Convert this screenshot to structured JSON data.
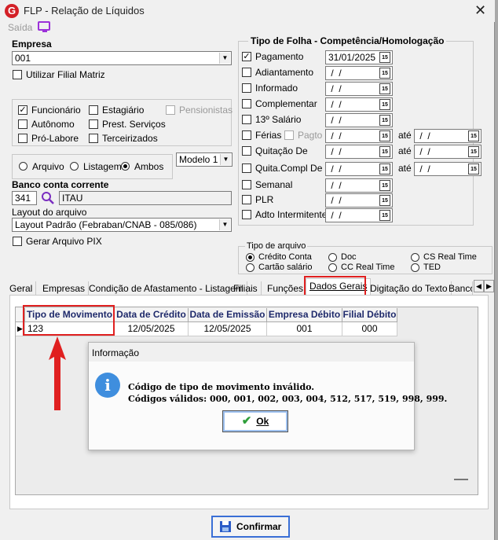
{
  "window": {
    "title": "FLP - Relação de Líquidos",
    "logo": "G",
    "close_icon": "✕"
  },
  "menu": {
    "saida": "Saída",
    "icon": "monitor-icon"
  },
  "empresa": {
    "label": "Empresa",
    "value": "001",
    "utilizar_filial_matriz": "Utilizar Filial Matriz"
  },
  "categorias": {
    "funcionario": "Funcionário",
    "estagiario": "Estagiário",
    "pensionistas": "Pensionistas",
    "autonomo": "Autônomo",
    "prest_servicos": "Prest. Serviços",
    "pro_labore": "Pró-Labore",
    "terceirizados": "Terceirizados"
  },
  "listagem": {
    "arquivo": "Arquivo",
    "listagem": "Listagem",
    "ambos": "Ambos",
    "modelo": "Modelo 1"
  },
  "banco": {
    "label": "Banco conta corrente",
    "code": "341",
    "name": "ITAU"
  },
  "layout": {
    "label": "Layout do arquivo",
    "value": "Layout Padrão (Febraban/CNAB - 085/086)",
    "pix": "Gerar Arquivo PIX"
  },
  "tipo_folha": {
    "header": "Tipo de Folha  -  Competência/Homologação",
    "ate": "até",
    "pagto": "Pagto",
    "cal": "15",
    "rows": [
      {
        "label": "Pagamento",
        "date": "31/01/2025"
      },
      {
        "label": "Adiantamento",
        "date": " /  /"
      },
      {
        "label": "Informado",
        "date": " /  /"
      },
      {
        "label": "Complementar",
        "date": " /  /"
      },
      {
        "label": "13º Salário",
        "date": " /  /"
      },
      {
        "label": "Férias",
        "date": " /  /",
        "date2": " /  /"
      },
      {
        "label": "Quitação De",
        "date": " /  /",
        "date2": " /  /"
      },
      {
        "label": "Quita.Compl De",
        "date": " /  /",
        "date2": " /  /"
      },
      {
        "label": "Semanal",
        "date": " /  /"
      },
      {
        "label": "PLR",
        "date": " /  /"
      },
      {
        "label": "Adto Intermitente",
        "date": " /  /"
      }
    ]
  },
  "tipo_arquivo": {
    "legend": "Tipo de arquivo",
    "credito_conta": "Crédito Conta",
    "cartao_salario": "Cartão salário",
    "doc": "Doc",
    "cc_real_time": "CC Real Time",
    "cs_real_time": "CS Real Time",
    "ted": "TED"
  },
  "tabs": [
    "Geral",
    "Empresas",
    "Condição de Afastamento - Listagem",
    "Filiais",
    "Funções",
    "Dados Gerais",
    "Digitação do Texto",
    "Banco"
  ],
  "grid": {
    "headers": [
      "Tipo de Movimento",
      "Data de Crédito",
      "Data de Emissão",
      "Empresa Débito",
      "Filial Débito"
    ],
    "row": [
      "123",
      "12/05/2025",
      "12/05/2025",
      "001",
      "000"
    ]
  },
  "dialog": {
    "title": "Informação",
    "line1": "Código de tipo de movimento inválido.",
    "line2": "Códigos válidos: 000, 001, 002, 003, 004, 512, 517, 519, 998, 999.",
    "ok": "Ok",
    "icon": "i"
  },
  "confirmar": "Confirmar",
  "colors": {
    "highlight_red": "#e02020",
    "info_blue": "#3f8ede",
    "header_navy": "#1f2a6b"
  }
}
